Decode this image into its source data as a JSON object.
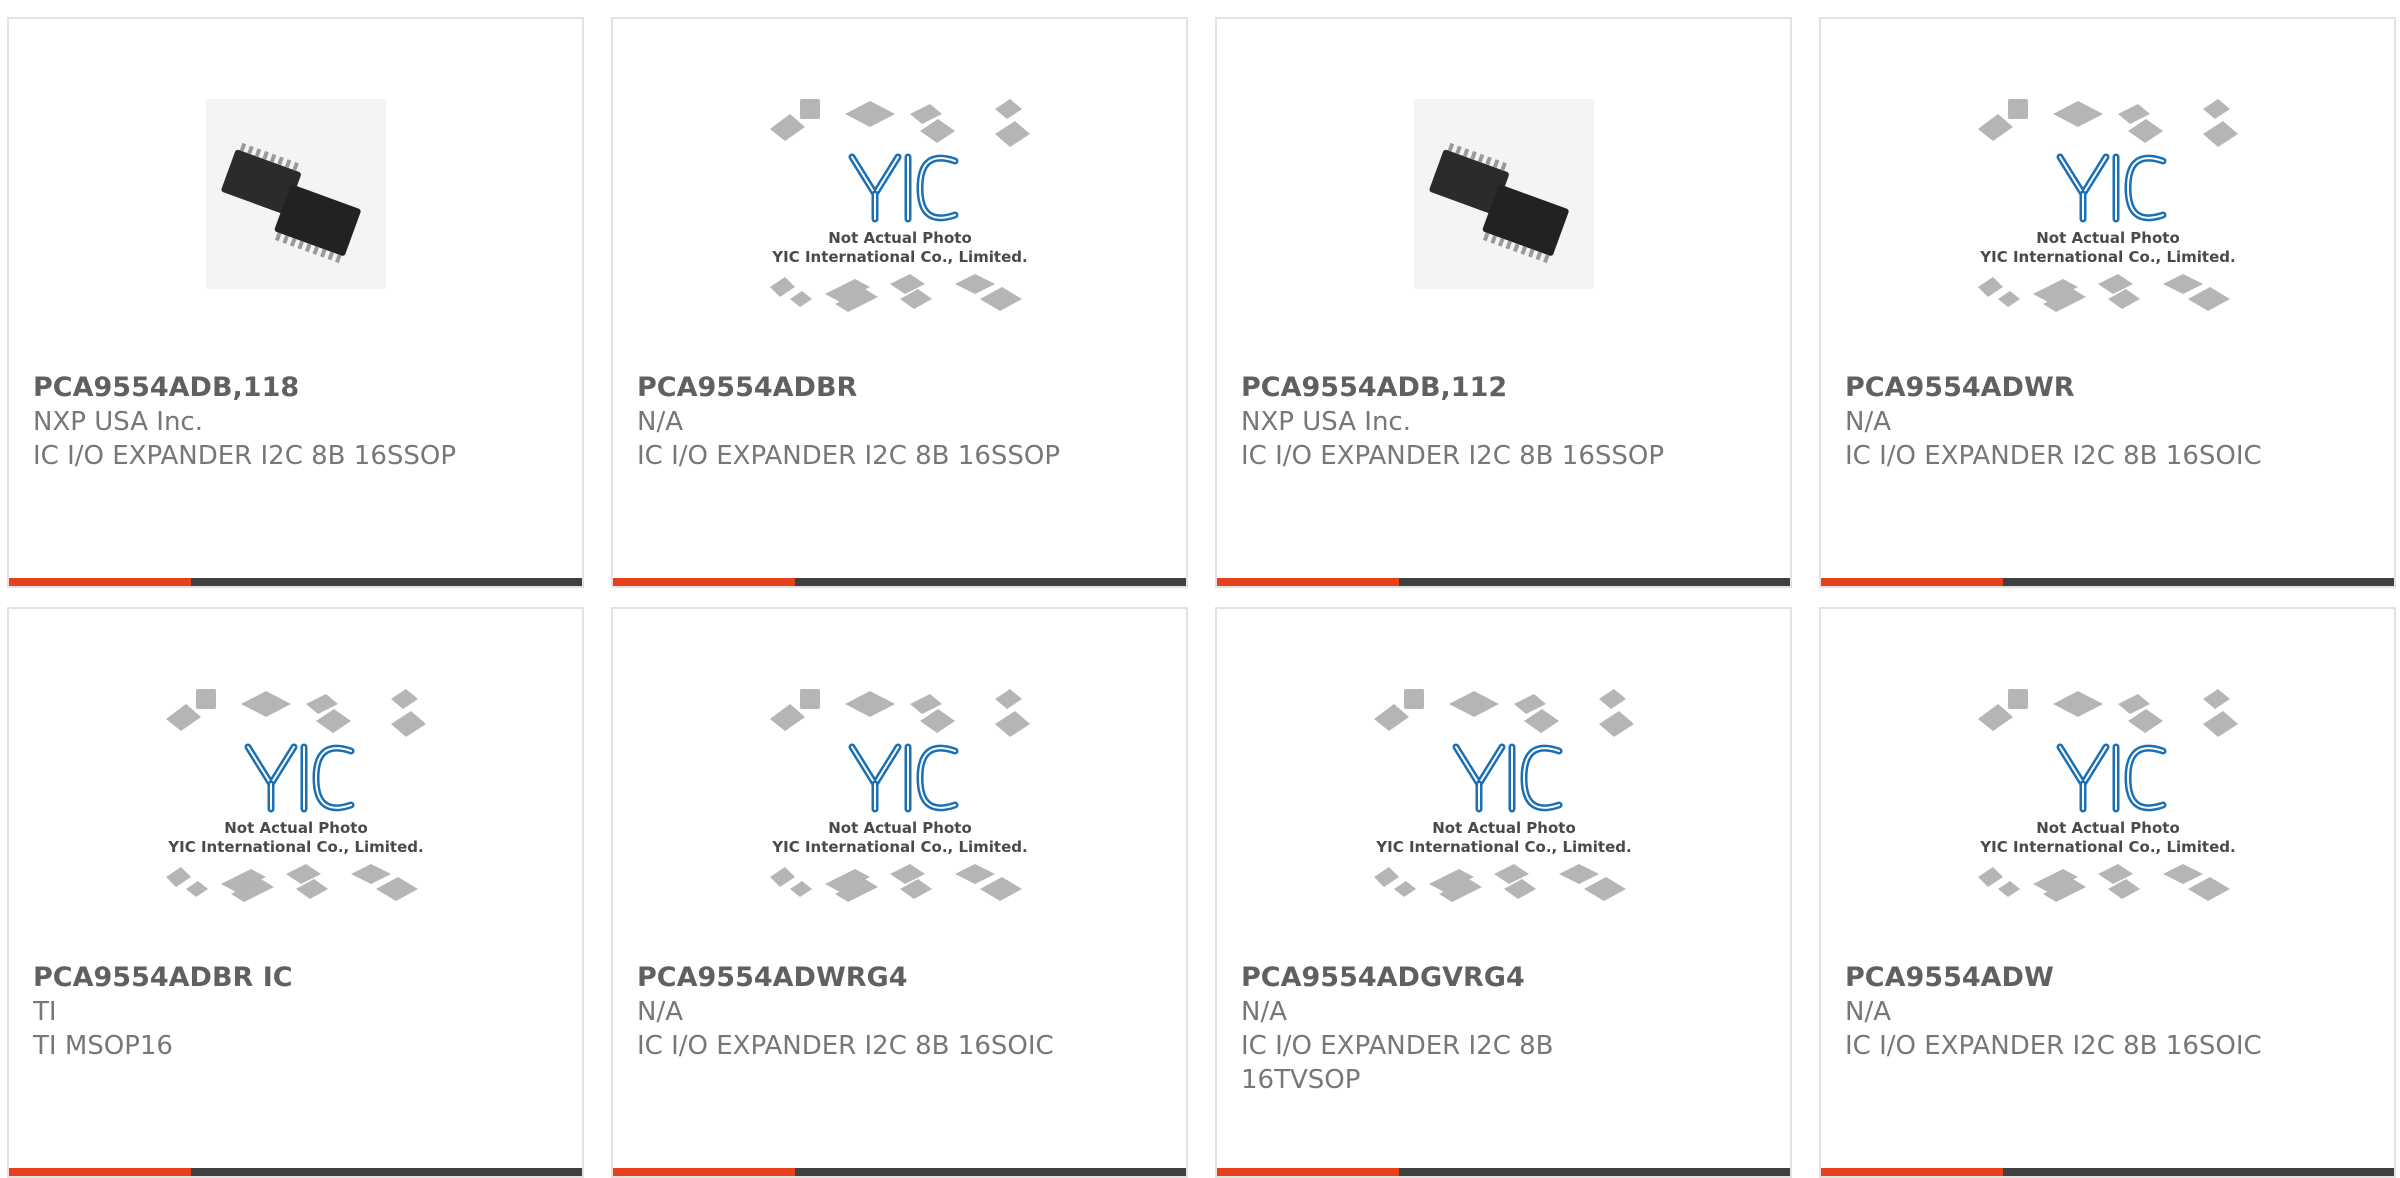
{
  "products": [
    {
      "part_number": "PCA9554ADB,118",
      "manufacturer": "NXP USA Inc.",
      "description": "IC I/O EXPANDER I2C 8B 16SSOP",
      "image": "chip-photo"
    },
    {
      "part_number": "PCA9554ADBR",
      "manufacturer": "N/A",
      "description": "IC I/O EXPANDER I2C 8B 16SSOP",
      "image": "placeholder"
    },
    {
      "part_number": "PCA9554ADB,112",
      "manufacturer": "NXP USA Inc.",
      "description": "IC I/O EXPANDER I2C 8B 16SSOP",
      "image": "chip-photo"
    },
    {
      "part_number": "PCA9554ADWR",
      "manufacturer": "N/A",
      "description": "IC I/O EXPANDER I2C 8B 16SOIC",
      "image": "placeholder"
    },
    {
      "part_number": "PCA9554ADBR IC",
      "manufacturer": "TI",
      "description": "TI MSOP16",
      "image": "placeholder"
    },
    {
      "part_number": "PCA9554ADWRG4",
      "manufacturer": "N/A",
      "description": "IC I/O EXPANDER I2C 8B 16SOIC",
      "image": "placeholder"
    },
    {
      "part_number": "PCA9554ADGVRG4",
      "manufacturer": "N/A",
      "description": "IC I/O EXPANDER I2C 8B 16TVSOP",
      "image": "placeholder"
    },
    {
      "part_number": "PCA9554ADW",
      "manufacturer": "N/A",
      "description": "IC I/O EXPANDER I2C 8B 16SOIC",
      "image": "placeholder"
    }
  ],
  "placeholder": {
    "line1": "Not Actual Photo",
    "line2": "YIC International Co., Limited.",
    "logo": "YIC"
  },
  "colors": {
    "accent": "#e8401a",
    "bar": "#404040",
    "logo_blue": "#1a6fb5"
  }
}
